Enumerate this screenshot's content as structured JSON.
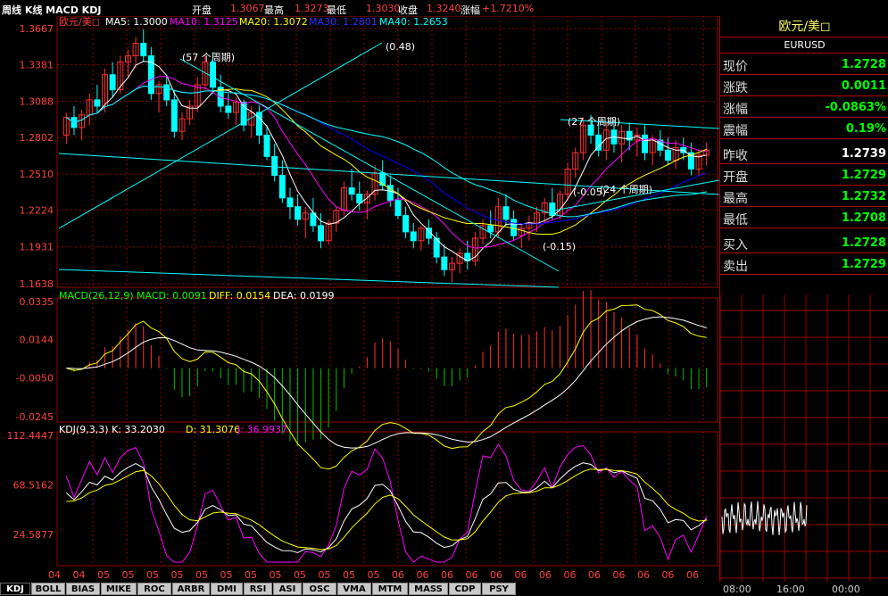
{
  "header": {
    "title": "周线 K线 MACD KDJ",
    "open_label": "开盘",
    "open_value": "1.3067",
    "high_label": "最高",
    "high_value": "1.3273",
    "low_label": "最低",
    "low_value": "1.3030",
    "close_label": "收盘",
    "close_value": "1.3240",
    "change_label": "涨幅",
    "change_value": "+1.7210%"
  },
  "colors": {
    "up": "#ff3030",
    "down": "#00ffff",
    "ma5": "#ffffff",
    "ma10": "#ff00ff",
    "ma20": "#ffff00",
    "ma30": "#0000ff",
    "ma40": "#00ffff",
    "grid": "#9a0000",
    "axis_text": "#ff4040",
    "macd_up": "#ff3030",
    "macd_down": "#00c000",
    "kdj_k": "#ffffff",
    "kdj_d": "#ffff00",
    "kdj_j": "#ff00ff"
  },
  "price_panel": {
    "legend_symbol": "欧元/美◻",
    "ma5": "MA5: 1.3000",
    "ma10": "MA10: 1.3125",
    "ma20": "MA20: 1.3072",
    "ma30": "MA30: 1.2801",
    "ma40": "MA40: 1.2653",
    "y_ticks": [
      "1.3667",
      "1.3381",
      "1.3088",
      "1.2802",
      "1.2510",
      "1.2224",
      "1.1931",
      "1.1638"
    ],
    "annotations": [
      "(57 个周期)",
      "(0.48)",
      "(27 个周期)",
      "(-0.05)",
      "(24 个周期)",
      "(-0.15)"
    ]
  },
  "macd_panel": {
    "legend": "MACD(26,12,9) MACD: 0.0091",
    "diff": "DIFF: 0.0154",
    "dea": "DEA: 0.0199",
    "y_ticks": [
      "0.0335",
      "0.0144",
      "-0.0050",
      "-0.0245"
    ]
  },
  "kdj_panel": {
    "legend": "KDJ(9,3,3) K: 33.2030",
    "d": "D: 31.3076",
    "j": "J: 36.9937",
    "y_ticks": [
      "112.4447",
      "68.5162",
      "24.5877"
    ]
  },
  "x_axis": [
    "04",
    "04",
    "05",
    "05",
    "05",
    "05",
    "05",
    "05",
    "05",
    "05",
    "05",
    "05",
    "05",
    "05",
    "06",
    "06",
    "06",
    "06",
    "06",
    "06",
    "06",
    "06",
    "06",
    "06",
    "06",
    "06",
    "06"
  ],
  "quote": {
    "title": "欧元/美◻",
    "symbol": "EURUSD",
    "rows": [
      {
        "label": "现价",
        "value": "1.2728",
        "color": "green"
      },
      {
        "label": "涨跌",
        "value": "0.0011",
        "color": "green"
      },
      {
        "label": "涨幅",
        "value": "-0.0863%",
        "color": "green"
      },
      {
        "label": "震幅",
        "value": "0.19%",
        "color": "green"
      },
      {
        "label": "昨收",
        "value": "1.2739",
        "color": "white"
      },
      {
        "label": "开盘",
        "value": "1.2729",
        "color": "green"
      },
      {
        "label": "最高",
        "value": "1.2732",
        "color": "green"
      },
      {
        "label": "最低",
        "value": "1.2708",
        "color": "green"
      },
      {
        "label": "买入",
        "value": "1.2728",
        "color": "green"
      },
      {
        "label": "卖出",
        "value": "1.2729",
        "color": "green"
      }
    ]
  },
  "tabs": [
    "KDJ",
    "BOLL",
    "BIAS",
    "MIKE",
    "ROC",
    "ARBR",
    "DMI",
    "RSI",
    "ASI",
    "OSC",
    "VMA",
    "MTM",
    "MASS",
    "CDP",
    "PSY"
  ],
  "time_axis": [
    "08:00",
    "16:00",
    "00:00"
  ],
  "chart_data": [
    {
      "type": "candlestick",
      "title": "欧元/美◻",
      "ylim": [
        1.1638,
        1.3667
      ],
      "candles": [
        [
          1.282,
          1.3,
          1.275,
          1.296
        ],
        [
          1.296,
          1.305,
          1.282,
          1.288
        ],
        [
          1.288,
          1.302,
          1.278,
          1.298
        ],
        [
          1.298,
          1.315,
          1.29,
          1.31
        ],
        [
          1.31,
          1.322,
          1.3,
          1.305
        ],
        [
          1.305,
          1.335,
          1.3,
          1.33
        ],
        [
          1.33,
          1.34,
          1.312,
          1.318
        ],
        [
          1.318,
          1.345,
          1.315,
          1.34
        ],
        [
          1.34,
          1.35,
          1.328,
          1.345
        ],
        [
          1.345,
          1.36,
          1.335,
          1.355
        ],
        [
          1.355,
          1.366,
          1.34,
          1.345
        ],
        [
          1.345,
          1.352,
          1.31,
          1.315
        ],
        [
          1.315,
          1.325,
          1.3,
          1.322
        ],
        [
          1.322,
          1.33,
          1.305,
          1.31
        ],
        [
          1.31,
          1.318,
          1.28,
          1.285
        ],
        [
          1.285,
          1.3,
          1.278,
          1.295
        ],
        [
          1.295,
          1.31,
          1.29,
          1.305
        ],
        [
          1.305,
          1.328,
          1.3,
          1.322
        ],
        [
          1.322,
          1.345,
          1.318,
          1.34
        ],
        [
          1.34,
          1.348,
          1.315,
          1.32
        ],
        [
          1.32,
          1.33,
          1.3,
          1.305
        ],
        [
          1.305,
          1.315,
          1.295,
          1.3
        ],
        [
          1.3,
          1.312,
          1.29,
          1.308
        ],
        [
          1.308,
          1.31,
          1.285,
          1.29
        ],
        [
          1.29,
          1.305,
          1.28,
          1.3
        ],
        [
          1.3,
          1.306,
          1.275,
          1.282
        ],
        [
          1.282,
          1.29,
          1.262,
          1.265
        ],
        [
          1.265,
          1.275,
          1.245,
          1.25
        ],
        [
          1.25,
          1.262,
          1.228,
          1.232
        ],
        [
          1.232,
          1.24,
          1.215,
          1.225
        ],
        [
          1.225,
          1.235,
          1.21,
          1.215
        ],
        [
          1.215,
          1.225,
          1.2,
          1.22
        ],
        [
          1.22,
          1.232,
          1.205,
          1.21
        ],
        [
          1.21,
          1.22,
          1.192,
          1.198
        ],
        [
          1.198,
          1.215,
          1.195,
          1.212
        ],
        [
          1.212,
          1.225,
          1.205,
          1.222
        ],
        [
          1.222,
          1.245,
          1.218,
          1.24
        ],
        [
          1.24,
          1.255,
          1.23,
          1.235
        ],
        [
          1.235,
          1.245,
          1.222,
          1.228
        ],
        [
          1.228,
          1.238,
          1.215,
          1.235
        ],
        [
          1.235,
          1.258,
          1.23,
          1.252
        ],
        [
          1.252,
          1.262,
          1.238,
          1.242
        ],
        [
          1.242,
          1.25,
          1.225,
          1.23
        ],
        [
          1.23,
          1.24,
          1.215,
          1.218
        ],
        [
          1.218,
          1.225,
          1.2,
          1.205
        ],
        [
          1.205,
          1.212,
          1.192,
          1.198
        ],
        [
          1.198,
          1.21,
          1.19,
          1.208
        ],
        [
          1.208,
          1.215,
          1.195,
          1.2
        ],
        [
          1.2,
          1.205,
          1.18,
          1.185
        ],
        [
          1.185,
          1.195,
          1.17,
          1.175
        ],
        [
          1.175,
          1.185,
          1.165,
          1.18
        ],
        [
          1.18,
          1.192,
          1.172,
          1.188
        ],
        [
          1.188,
          1.198,
          1.175,
          1.182
        ],
        [
          1.182,
          1.205,
          1.178,
          1.2
        ],
        [
          1.2,
          1.215,
          1.195,
          1.21
        ],
        [
          1.21,
          1.222,
          1.2,
          1.205
        ],
        [
          1.205,
          1.232,
          1.2,
          1.225
        ],
        [
          1.225,
          1.235,
          1.21,
          1.215
        ],
        [
          1.215,
          1.222,
          1.198,
          1.202
        ],
        [
          1.202,
          1.212,
          1.192,
          1.208
        ],
        [
          1.208,
          1.218,
          1.198,
          1.212
        ],
        [
          1.212,
          1.225,
          1.205,
          1.22
        ],
        [
          1.22,
          1.232,
          1.212,
          1.228
        ],
        [
          1.228,
          1.24,
          1.215,
          1.218
        ],
        [
          1.218,
          1.238,
          1.215,
          1.235
        ],
        [
          1.235,
          1.26,
          1.23,
          1.255
        ],
        [
          1.255,
          1.272,
          1.248,
          1.268
        ],
        [
          1.268,
          1.296,
          1.262,
          1.29
        ],
        [
          1.29,
          1.298,
          1.275,
          1.282
        ],
        [
          1.282,
          1.296,
          1.265,
          1.27
        ],
        [
          1.27,
          1.292,
          1.262,
          1.286
        ],
        [
          1.286,
          1.294,
          1.268,
          1.275
        ],
        [
          1.275,
          1.29,
          1.26,
          1.285
        ],
        [
          1.285,
          1.292,
          1.27,
          1.278
        ],
        [
          1.278,
          1.288,
          1.265,
          1.282
        ],
        [
          1.282,
          1.29,
          1.262,
          1.268
        ],
        [
          1.268,
          1.282,
          1.258,
          1.278
        ],
        [
          1.278,
          1.286,
          1.265,
          1.27
        ],
        [
          1.27,
          1.28,
          1.258,
          1.262
        ],
        [
          1.262,
          1.278,
          1.255,
          1.272
        ],
        [
          1.272,
          1.28,
          1.262,
          1.268
        ],
        [
          1.268,
          1.276,
          1.25,
          1.255
        ],
        [
          1.255,
          1.27,
          1.25,
          1.266
        ],
        [
          1.266,
          1.276,
          1.258,
          1.27
        ]
      ]
    },
    {
      "type": "bar",
      "title": "MACD(26,12,9)",
      "ylim": [
        -0.0245,
        0.0335
      ],
      "diff_last": 0.0154,
      "dea_last": 0.0199,
      "macd_last": 0.0091
    },
    {
      "type": "line",
      "title": "KDJ(9,3,3)",
      "ylim": [
        0,
        112.4447
      ],
      "k_last": 33.203,
      "d_last": 31.3076,
      "j_last": 36.9937
    }
  ]
}
